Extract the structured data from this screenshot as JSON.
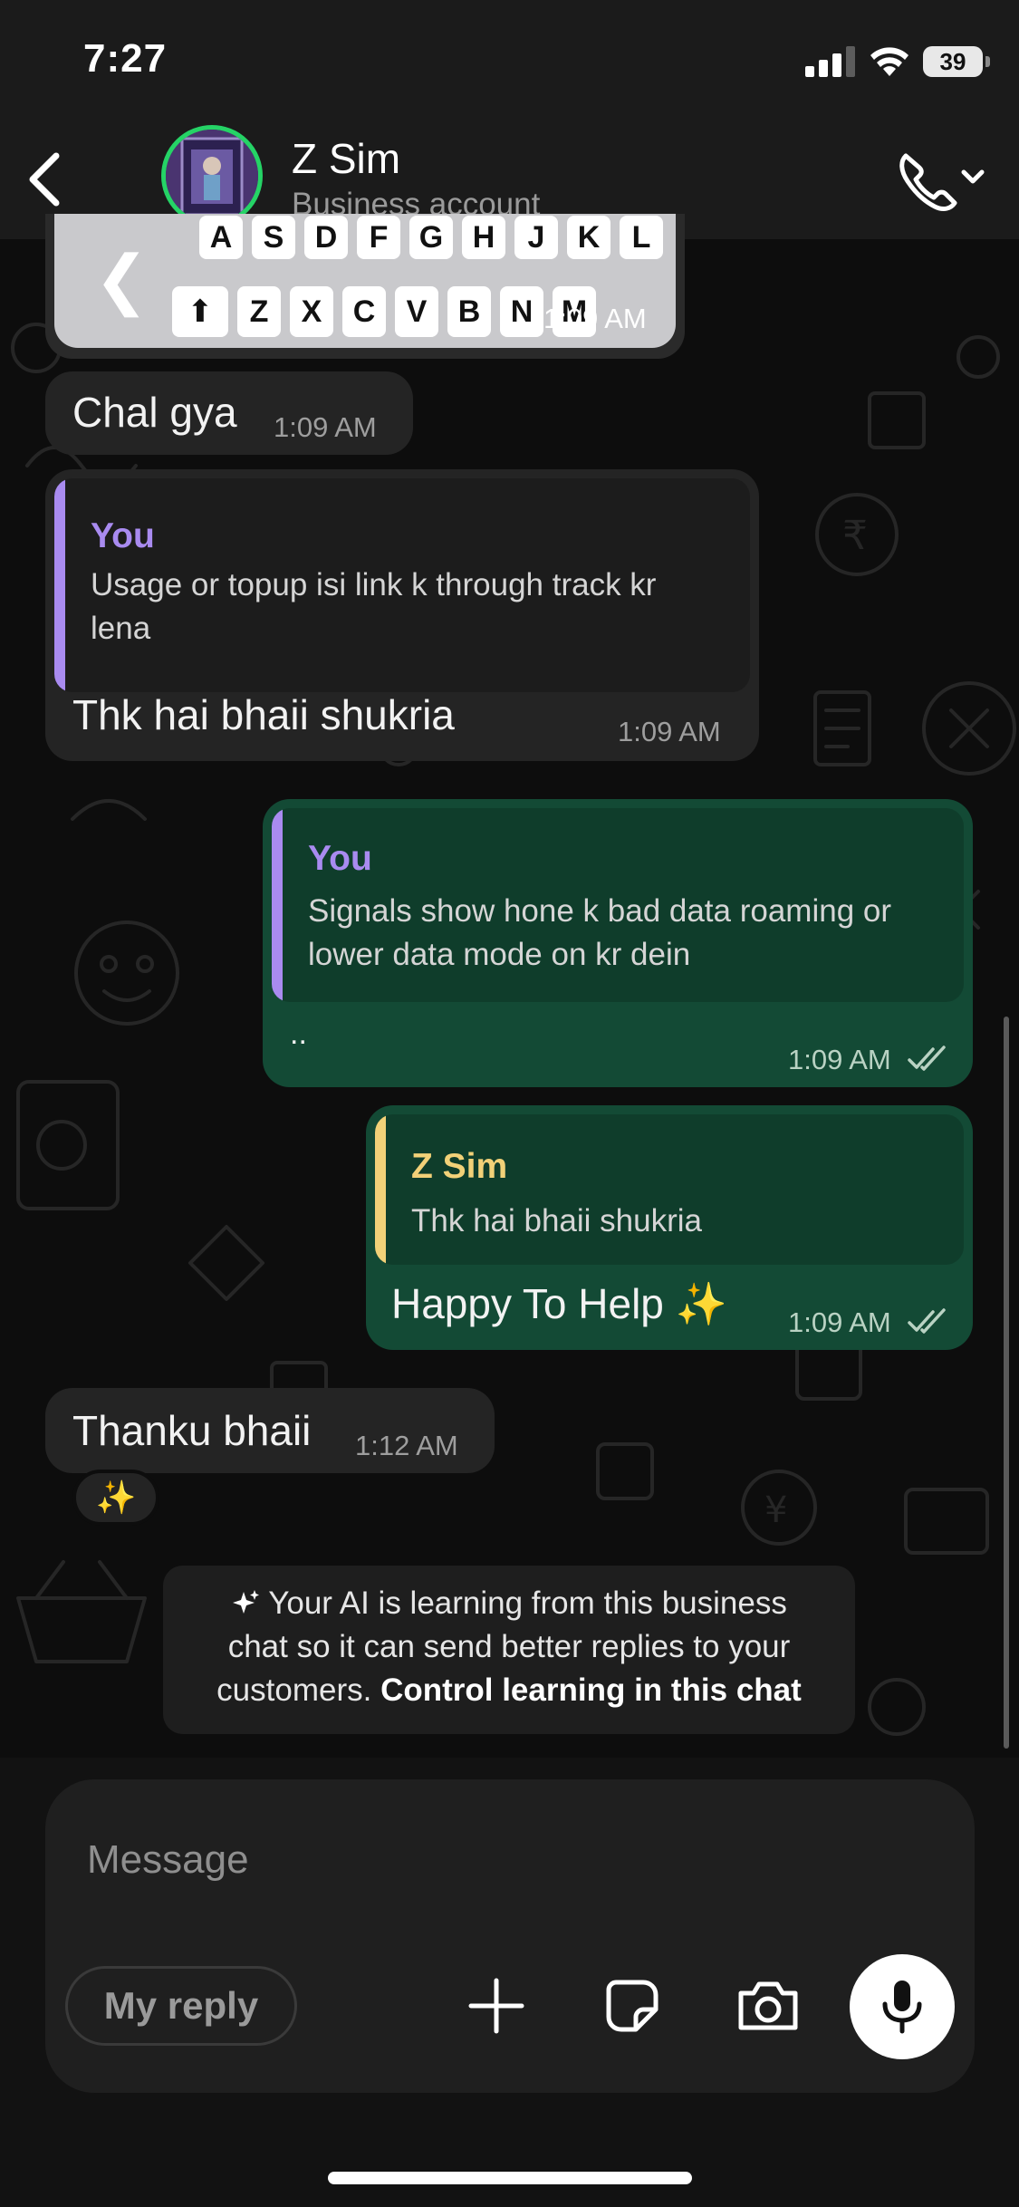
{
  "status_bar": {
    "time": "7:27",
    "battery": "39"
  },
  "header": {
    "name": "Z Sim",
    "subtitle": "Business account"
  },
  "messages": {
    "image_msg": {
      "time": "1:09 AM",
      "keys_row1": "A S D F G H J K L",
      "keys_row2": "Z X C V B N M"
    },
    "m1": {
      "text": "Chal gya",
      "time": "1:09 AM"
    },
    "m2": {
      "quote_author": "You",
      "quote_line1": "Usage or topup  isi link k through track kr",
      "quote_line2": "lena",
      "text": "Thk hai bhaii shukria",
      "time": "1:09 AM"
    },
    "m3": {
      "quote_author": "You",
      "quote_line1": "Signals show hone k bad data roaming or",
      "quote_line2": "lower data mode on kr dein",
      "text": "..",
      "time": "1:09 AM"
    },
    "m4": {
      "quote_author": "Z Sim",
      "quote_line1": "Thk hai bhaii shukria",
      "text": "Happy To Help ✨",
      "time": "1:09 AM"
    },
    "m5": {
      "text": "Thanku bhaii",
      "time": "1:12 AM",
      "reaction": "✨"
    }
  },
  "ai_notice": {
    "icon": "sparkles-icon",
    "line1": "Your AI is learning from this business",
    "line2": "chat so it can send better replies to your",
    "line3_plain": "customers. ",
    "line3_link": "Control learning in this chat"
  },
  "composer": {
    "placeholder": "Message",
    "my_reply_label": "My reply"
  },
  "colors": {
    "outgoing_bubble": "#134a35",
    "incoming_bubble": "#242424",
    "quote_you": "#a98bf0",
    "quote_zsim": "#f2d178",
    "avatar_ring": "#25d366"
  }
}
